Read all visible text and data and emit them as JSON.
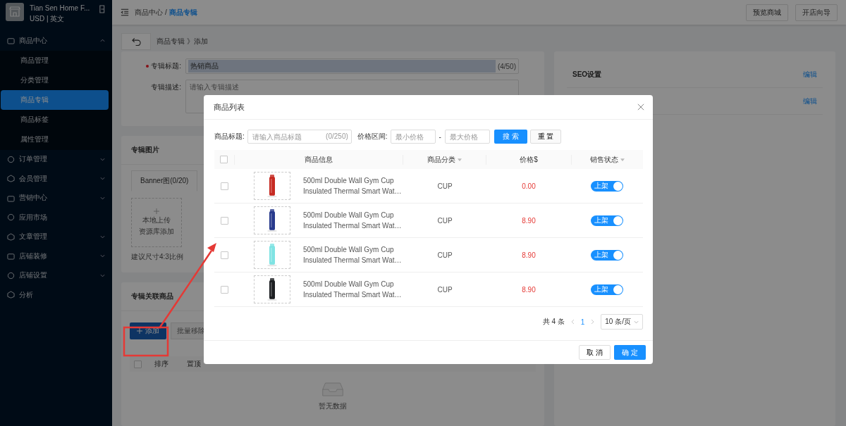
{
  "sidebar": {
    "store_name": "Tian Sen Home F...",
    "currency_lang": "USD | 英文",
    "menu": [
      {
        "label": "商品中心",
        "expanded": true,
        "children": [
          {
            "label": "商品管理",
            "selected": false
          },
          {
            "label": "分类管理",
            "selected": false
          },
          {
            "label": "商品专辑",
            "selected": true
          },
          {
            "label": "商品标签",
            "selected": false
          },
          {
            "label": "属性管理",
            "selected": false
          }
        ]
      },
      {
        "label": "订单管理",
        "expanded": false
      },
      {
        "label": "会员管理",
        "expanded": false
      },
      {
        "label": "营销中心",
        "expanded": false
      },
      {
        "label": "应用市场"
      },
      {
        "label": "文章管理",
        "expanded": false
      },
      {
        "label": "店铺装修",
        "expanded": false
      },
      {
        "label": "店铺设置",
        "expanded": false
      },
      {
        "label": "分析"
      }
    ]
  },
  "header": {
    "breadcrumb": [
      "商品中心",
      "商品专辑"
    ],
    "breadcrumb_separator": "/",
    "buttons": [
      "预览商城",
      "开店向导"
    ]
  },
  "page": {
    "path": "商品专辑 》添加",
    "form": [
      {
        "label": "专辑标题:",
        "required": true,
        "value": "热销商品",
        "counter": "(4/50)"
      },
      {
        "label": "专辑描述:",
        "required": false,
        "placeholder": "请输入专辑描述"
      }
    ],
    "seo": [
      {
        "label": "SEO设置",
        "action": "编辑"
      },
      {
        "action": "编辑"
      }
    ],
    "images": {
      "title": "专辑图片",
      "tabs": [
        {
          "label": "Banner图(0/20)",
          "selected": true
        }
      ],
      "upload_lines": [
        "本地上传",
        "资源库添加"
      ],
      "hint": "建议尺寸4:3比例"
    },
    "related": {
      "title": "专辑关联商品",
      "add": "添加",
      "batch_remove": {
        "label": "批量移除",
        "disabled": true
      },
      "select_all_checked": false,
      "columns": [
        "排序",
        "置顶"
      ],
      "empty": "暂无数据"
    }
  },
  "modal": {
    "title": "商品列表",
    "filter": {
      "title_label": "商品标题:",
      "title_placeholder": "请输入商品标题",
      "title_counter": "(0/250)",
      "price_label": "价格区间:",
      "min_placeholder": "最小价格",
      "separator": "-",
      "max_placeholder": "最大价格",
      "search": "搜 索",
      "reset": "重 置"
    },
    "select_all_checked": false,
    "columns": [
      {
        "label": "商品信息",
        "filter": false
      },
      {
        "label": "商品分类",
        "filter": true
      },
      {
        "label": "价格$",
        "filter": false
      },
      {
        "label": "销售状态",
        "filter": true
      }
    ],
    "rows": [
      {
        "checked": false,
        "title_lines": [
          "500ml Double Wall Gym Cup",
          "Insulated Thermal Smart Wat…"
        ],
        "category": "CUP",
        "price": "0.00",
        "status": "上架",
        "on": true
      },
      {
        "checked": false,
        "title_lines": [
          "500ml Double Wall Gym Cup",
          "Insulated Thermal Smart Wat…"
        ],
        "category": "CUP",
        "price": "8.90",
        "status": "上架",
        "on": true
      },
      {
        "checked": false,
        "title_lines": [
          "500ml Double Wall Gym Cup",
          "Insulated Thermal Smart Wat…"
        ],
        "category": "CUP",
        "price": "8.90",
        "status": "上架",
        "on": true
      },
      {
        "checked": false,
        "title_lines": [
          "500ml Double Wall Gym Cup",
          "Insulated Thermal Smart Wat…"
        ],
        "category": "CUP",
        "price": "8.90",
        "status": "上架",
        "on": true
      }
    ],
    "pagination": {
      "total": "共 4 条",
      "pages": [
        {
          "label": "1",
          "selected": true
        }
      ],
      "page_size": "10 条/页"
    },
    "buttons": {
      "cancel": "取 消",
      "ok": "确 定"
    }
  }
}
